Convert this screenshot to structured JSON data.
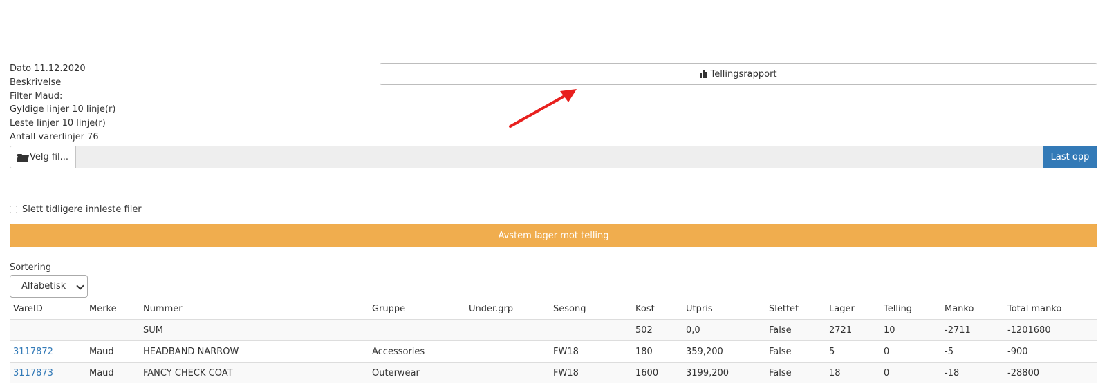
{
  "info": {
    "date": "Dato 11.12.2020",
    "description": "Beskrivelse",
    "filter": "Filter Maud:",
    "valid_lines": "Gyldige linjer 10 linje(r)",
    "read_lines": "Leste linjer 10 linje(r)",
    "item_lines": "Antall varerlinjer 76"
  },
  "report_button": {
    "label": "Tellingsrapport",
    "icon": "bar-chart-icon"
  },
  "upload": {
    "choose_label": "Velg fil...",
    "choose_icon": "folder-open-icon",
    "upload_label": "Last opp",
    "file_value": ""
  },
  "delete_checkbox": {
    "label": "Slett tidligere innleste filer",
    "checked": false
  },
  "reconcile_button": {
    "label": "Avstem lager mot telling"
  },
  "sorting": {
    "label": "Sortering",
    "selected": "Alfabetisk"
  },
  "colors": {
    "primary": "#337ab7",
    "warning": "#f0ad4e",
    "arrow": "#e8201e"
  },
  "table": {
    "headers": [
      "VareID",
      "Merke",
      "Nummer",
      "Gruppe",
      "Under.grp",
      "Sesong",
      "Kost",
      "Utpris",
      "Slettet",
      "Lager",
      "Telling",
      "Manko",
      "Total manko"
    ],
    "rows": [
      [
        "",
        "",
        "SUM",
        "",
        "",
        "",
        "502",
        "0,0",
        "False",
        "2721",
        "10",
        "-2711",
        "-1201680"
      ],
      [
        "3117872",
        "Maud",
        "HEADBAND NARROW",
        "Accessories",
        "",
        "FW18",
        "180",
        "359,200",
        "False",
        "5",
        "0",
        "-5",
        "-900"
      ],
      [
        "3117873",
        "Maud",
        "FANCY CHECK COAT",
        "Outerwear",
        "",
        "FW18",
        "1600",
        "3199,200",
        "False",
        "18",
        "0",
        "-18",
        "-28800"
      ]
    ]
  }
}
